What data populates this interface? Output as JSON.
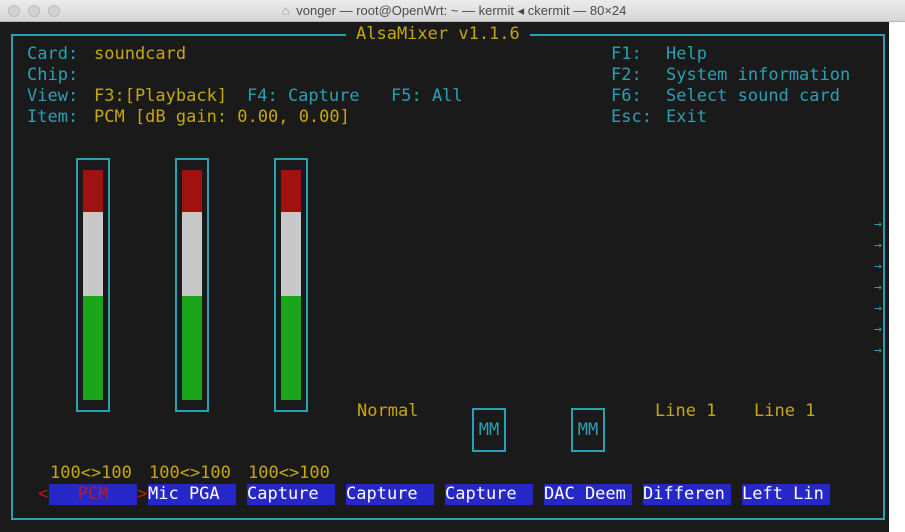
{
  "window": {
    "title": "vonger — root@OpenWrt: ~ — kermit ◂ ckermit — 80×24"
  },
  "header": {
    "app_title": "AlsaMixer v1.1.6",
    "card_label": "Card:",
    "card_value": "soundcard",
    "chip_label": "Chip:",
    "view_label": "View:",
    "view_f3": "F3:[Playback]",
    "view_f4": "F4: Capture",
    "view_f5": "F5: All",
    "item_label": "Item:",
    "item_value": "PCM [dB gain: 0.00, 0.00]"
  },
  "help": [
    {
      "key": "F1:",
      "text": "Help"
    },
    {
      "key": "F2:",
      "text": "System information"
    },
    {
      "key": "F6:",
      "text": "Select sound card"
    },
    {
      "key": "Esc:",
      "text": "Exit"
    }
  ],
  "controls": [
    {
      "name": "PCM",
      "value": "100<>100",
      "level": 1.0,
      "selected": true
    },
    {
      "name": "Mic PGA",
      "value": "100<>100",
      "level": 1.0
    },
    {
      "name": "Capture",
      "value": "100<>100",
      "level": 1.0
    },
    {
      "name": "Capture",
      "enum_value": "Normal"
    },
    {
      "name": "Capture",
      "mute": "MM"
    },
    {
      "name": "DAC Deem",
      "mute": "MM"
    },
    {
      "name": "Differen",
      "enum_value": "Line 1"
    },
    {
      "name": "Left Lin",
      "enum_value": "Line 1"
    }
  ],
  "selection_markers": {
    "left": "<",
    "right": ">"
  },
  "scroll_arrow": "→",
  "colors": {
    "background": "#1a1a1a",
    "frame": "#2aa1b3",
    "text_yellow": "#c5a80f",
    "label_bg": "#2527c8",
    "selected_text": "#b81c1c",
    "meter_red": "#a01212",
    "meter_white": "#c8c8c8",
    "meter_green": "#1aa51a"
  }
}
